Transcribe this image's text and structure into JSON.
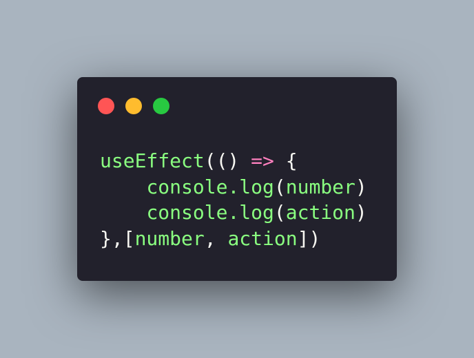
{
  "window": {
    "background": "#22212c",
    "traffic_lights": [
      {
        "name": "close-button",
        "color": "#ff5555"
      },
      {
        "name": "minimize-button",
        "color": "#ffbc2e"
      },
      {
        "name": "maximize-button",
        "color": "#28c941"
      }
    ]
  },
  "code": {
    "line1": {
      "fn": "useEffect",
      "open": "(()",
      "space": " ",
      "arrow": "=>",
      "space2": " ",
      "brace": "{"
    },
    "line2": {
      "indent": "    ",
      "obj": "console.log",
      "open": "(",
      "arg": "number",
      "close": ")"
    },
    "line3": {
      "indent": "    ",
      "obj": "console.log",
      "open": "(",
      "arg": "action",
      "close": ")"
    },
    "line4": {
      "brace": "},[",
      "dep1": "number",
      "comma": ",",
      "space": " ",
      "dep2": "action",
      "close": "])"
    }
  },
  "colors": {
    "identifier": "#8aff80",
    "punctuation": "#f8f8f2",
    "operator": "#ff80bf",
    "page_background": "#a9b4bf"
  }
}
